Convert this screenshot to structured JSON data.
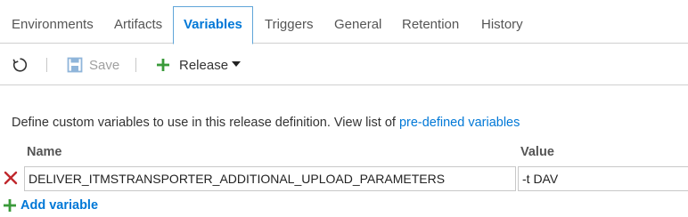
{
  "tabs": [
    {
      "label": "Environments",
      "active": false
    },
    {
      "label": "Artifacts",
      "active": false
    },
    {
      "label": "Variables",
      "active": true
    },
    {
      "label": "Triggers",
      "active": false
    },
    {
      "label": "General",
      "active": false
    },
    {
      "label": "Retention",
      "active": false
    },
    {
      "label": "History",
      "active": false
    }
  ],
  "toolbar": {
    "refresh_icon": "refresh-icon",
    "save_icon": "save-icon",
    "save_label": "Save",
    "save_enabled": false,
    "add_icon": "plus-icon",
    "release_label": "Release",
    "release_icon": "caret-down-icon"
  },
  "description": {
    "text": "Define custom variables to use in this release definition. View list of ",
    "link": "pre-defined variables"
  },
  "variables": {
    "name_header": "Name",
    "value_header": "Value",
    "rows": [
      {
        "name": "DELIVER_ITMSTRANSPORTER_ADDITIONAL_UPLOAD_PARAMETERS",
        "value": "-t DAV",
        "delete_icon": "delete-x-icon"
      }
    ],
    "add_label": "Add variable",
    "add_icon": "plus-icon"
  },
  "colors": {
    "accent": "#0078d7",
    "active_tab_border": "#5fa5d9",
    "add_green": "#3a9a3a",
    "delete_red": "#c0282d",
    "disabled": "#a0a0a0"
  }
}
